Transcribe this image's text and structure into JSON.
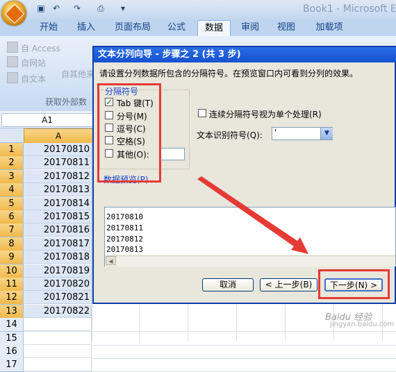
{
  "window": {
    "title": "Book1 - Microsoft Ex"
  },
  "quick_access": {
    "icons": [
      "save-icon",
      "undo-icon",
      "redo-icon",
      "print-preview-icon",
      "customize-icon"
    ]
  },
  "ribbon": {
    "tabs": [
      {
        "label": "开始",
        "active": false
      },
      {
        "label": "插入",
        "active": false
      },
      {
        "label": "页面布局",
        "active": false
      },
      {
        "label": "公式",
        "active": false
      },
      {
        "label": "数据",
        "active": true
      },
      {
        "label": "审阅",
        "active": false
      },
      {
        "label": "视图",
        "active": false
      },
      {
        "label": "加载项",
        "active": false
      }
    ],
    "external_data": {
      "access": "自 Access",
      "web": "自网站",
      "text": "自文本",
      "other": "自其他来",
      "group_label": "获取外部数"
    }
  },
  "formula_bar": {
    "name_box": "A1"
  },
  "sheet": {
    "column_header": "A",
    "rows": [
      {
        "num": "1",
        "value": "20170810"
      },
      {
        "num": "2",
        "value": "20170811"
      },
      {
        "num": "3",
        "value": "20170812"
      },
      {
        "num": "4",
        "value": "20170813"
      },
      {
        "num": "5",
        "value": "20170814"
      },
      {
        "num": "6",
        "value": "20170815"
      },
      {
        "num": "7",
        "value": "20170816"
      },
      {
        "num": "8",
        "value": "20170817"
      },
      {
        "num": "9",
        "value": "20170818"
      },
      {
        "num": "10",
        "value": "20170819"
      },
      {
        "num": "11",
        "value": "20170820"
      },
      {
        "num": "12",
        "value": "20170821"
      },
      {
        "num": "13",
        "value": "20170822"
      },
      {
        "num": "14",
        "value": ""
      },
      {
        "num": "15",
        "value": ""
      },
      {
        "num": "16",
        "value": ""
      },
      {
        "num": "17",
        "value": ""
      }
    ]
  },
  "dialog": {
    "title": "文本分列向导 - 步骤之 2 (共 3 步)",
    "description": "请设置分列数据所包含的分隔符号。在预览窗口内可看到分列的效果。",
    "separators": {
      "label": "分隔符号",
      "options": [
        {
          "label": "Tab 键(T)",
          "checked": true
        },
        {
          "label": "分号(M)",
          "checked": false
        },
        {
          "label": "逗号(C)",
          "checked": false
        },
        {
          "label": "空格(S)",
          "checked": false
        },
        {
          "label": "其他(O):",
          "checked": false
        }
      ]
    },
    "consecutive_label": "连续分隔符号视为单个处理(R)",
    "qualifier_label": "文本识别符号(Q):",
    "qualifier_value": "'",
    "preview_label": "数据预览(P)",
    "preview_lines": [
      "20170810",
      "20170811",
      "20170812",
      "20170813"
    ],
    "buttons": {
      "cancel": "取消",
      "back": "< 上一步(B)",
      "next": "下一步(N) >"
    }
  },
  "watermark": {
    "text": "Baidu 经验",
    "sub": "jingyan.baidu.com"
  },
  "colors": {
    "annotation_red": "#e53a36",
    "dialog_title_blue": "#1551cf"
  }
}
